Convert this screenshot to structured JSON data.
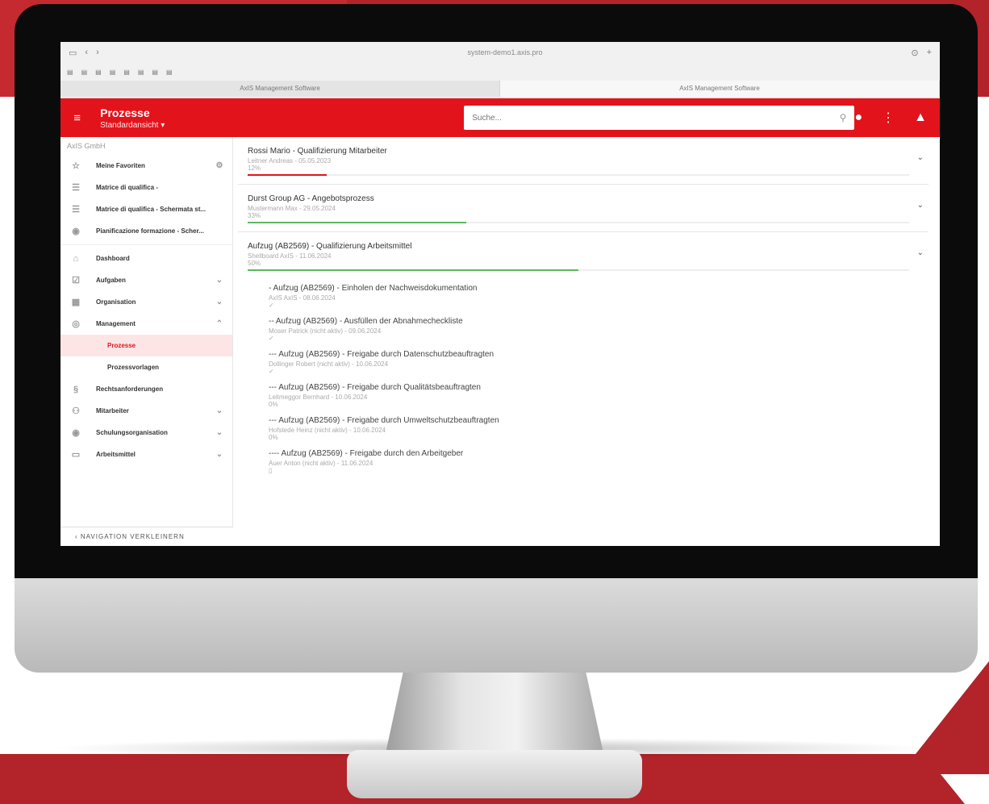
{
  "browser": {
    "url": "system-demo1.axis.pro",
    "tabs": [
      "AxIS Management Software",
      "AxIS Management Software"
    ]
  },
  "appbar": {
    "title": "Prozesse",
    "subtitle": "Standardansicht ▾",
    "search_placeholder": "Suche..."
  },
  "sidebar": {
    "company": "AxIS GmbH",
    "items": [
      {
        "label": "Meine Favoriten"
      },
      {
        "label": "Matrice di qualifica -"
      },
      {
        "label": "Matrice di qualifica - Schermata st..."
      },
      {
        "label": "Pianificazione formazione - Scher..."
      },
      {
        "label": "Dashboard"
      },
      {
        "label": "Aufgaben"
      },
      {
        "label": "Organisation"
      },
      {
        "label": "Management"
      },
      {
        "label": "Prozesse"
      },
      {
        "label": "Prozessvorlagen"
      },
      {
        "label": "Rechtsanforderungen"
      },
      {
        "label": "Mitarbeiter"
      },
      {
        "label": "Schulungsorganisation"
      },
      {
        "label": "Arbeitsmittel"
      }
    ],
    "collapse_label": "‹ NAVIGATION VERKLEINERN"
  },
  "processes": [
    {
      "title": "Rossi Mario - Qualifizierung Mitarbeiter",
      "meta": "Leitner Andreas - 05.05.2023",
      "pct_label": "12%",
      "progress": 0.12,
      "color": "#e3131b"
    },
    {
      "title": "Durst Group AG - Angebotsprozess",
      "meta": "Mustermann Max - 29.05.2024",
      "pct_label": "33%",
      "progress": 0.33,
      "color": "#5cb85c"
    },
    {
      "title": "Aufzug (AB2569) - Qualifizierung Arbeitsmittel",
      "meta": "Shellboard AxIS - 11.06.2024",
      "pct_label": "50%",
      "progress": 0.5,
      "color": "#5cb85c"
    }
  ],
  "subprocesses": [
    {
      "title": "- Aufzug (AB2569) - Einholen der Nachweisdokumentation",
      "meta": "AxIS AxIS - 08.06.2024",
      "status": "✓"
    },
    {
      "title": "-- Aufzug (AB2569) - Ausfüllen der Abnahmecheckliste",
      "meta": "Moser Patrick (nicht aktiv) - 09.06.2024",
      "status": "✓"
    },
    {
      "title": "--- Aufzug (AB2569) - Freigabe durch Datenschutzbeauftragten",
      "meta": "Dollinger Robert (nicht aktiv) - 10.06.2024",
      "status": "✓"
    },
    {
      "title": "--- Aufzug (AB2569) - Freigabe durch Qualitätsbeauftragten",
      "meta": "Leitmeggor Bernhard - 10.06.2024",
      "status": "0%"
    },
    {
      "title": "--- Aufzug (AB2569) - Freigabe durch Umweltschutzbeauftragten",
      "meta": "Hofstede Heinz (nicht aktiv) - 10.06.2024",
      "status": "0%"
    },
    {
      "title": "---- Aufzug (AB2569) - Freigabe durch den Arbeitgeber",
      "meta": "Auer Anton (nicht aktiv) - 11.06.2024",
      "status": "▯"
    }
  ]
}
